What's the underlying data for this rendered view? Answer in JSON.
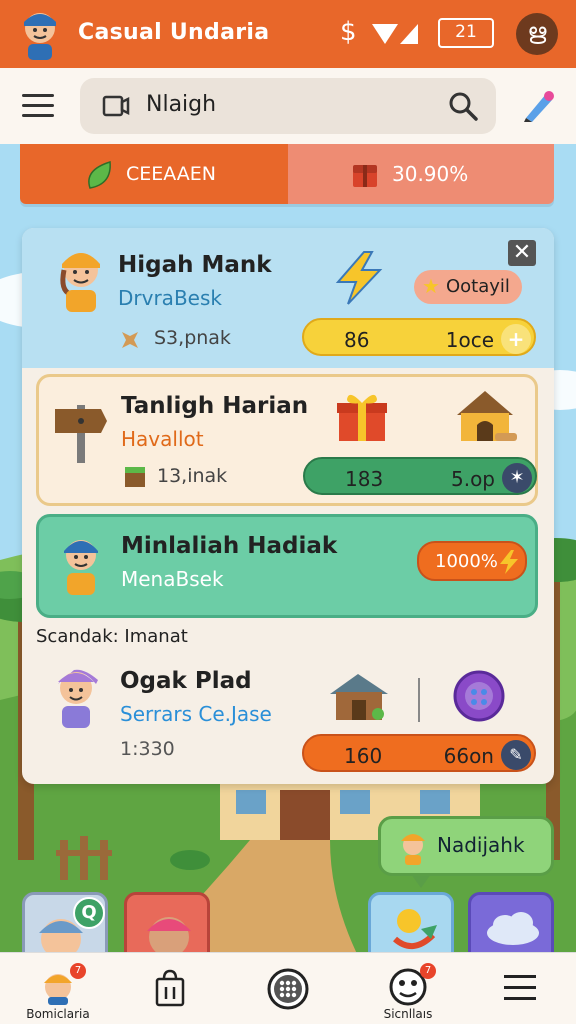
{
  "app": {
    "title": "Casual Undaria",
    "currency_symbol": "$",
    "counter": "21",
    "profile_initial": "ഋ"
  },
  "search": {
    "value": "Nlaigh"
  },
  "strip": {
    "left_label": "CEEAAEN",
    "right_label": "30.90%"
  },
  "cards": [
    {
      "title": "Higah Mank",
      "subtitle": "DrvraBesk",
      "meta": "S3,pnak",
      "pill": "Ootayil",
      "bar": {
        "left": "86",
        "right": "1oce",
        "end": "+"
      }
    },
    {
      "title": "Tanligh Harian",
      "subtitle": "Havallot",
      "meta": "13,inak",
      "bar": {
        "left": "183",
        "right": "5.op",
        "end": "✶"
      }
    },
    {
      "title": "Minlaliah Hadiak",
      "subtitle": "MenaBsek",
      "pill": "1000%"
    }
  ],
  "section_label": "Scandak: Imanat",
  "card4": {
    "title": "Ogak Plad",
    "subtitle": "Serrars Ce.Jase",
    "meta": "1:330",
    "bar": {
      "left": "160",
      "right": "66on",
      "end": "✎"
    }
  },
  "bubble": {
    "text": "Nadijahk"
  },
  "tile_badge": "Q",
  "nav": [
    {
      "label": "Bomiclaria",
      "badge": "7",
      "icon": "mascot-icon"
    },
    {
      "label": "",
      "icon": "shopping-bag-icon"
    },
    {
      "label": "",
      "icon": "dial-icon"
    },
    {
      "label": "Sicnllaıs",
      "badge": "7",
      "icon": "face-icon"
    },
    {
      "label": "",
      "icon": "menu-icon"
    }
  ],
  "colors": {
    "primary": "#e8672a",
    "accent_green": "#6ccda6",
    "yellow_bar": "#f7d23a",
    "green_bar": "#3ea266",
    "orange_bar": "#ef6d1f"
  }
}
